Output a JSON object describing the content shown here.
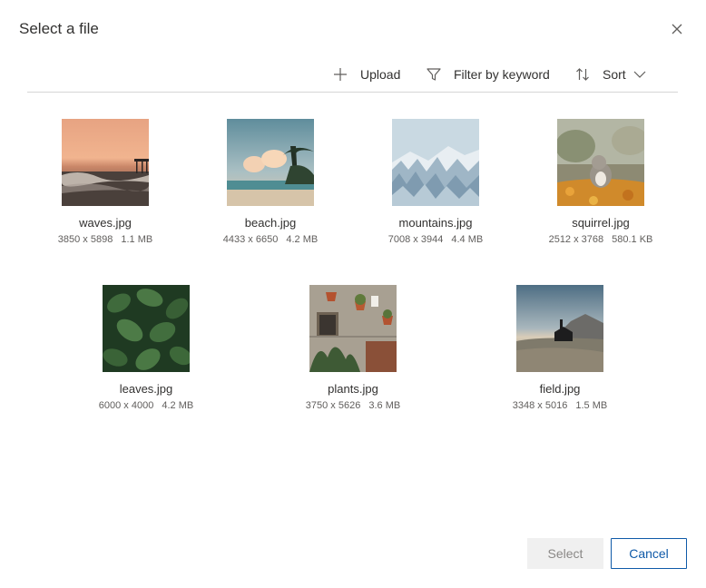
{
  "dialog": {
    "title": "Select a file"
  },
  "toolbar": {
    "upload_label": "Upload",
    "filter_label": "Filter by keyword",
    "sort_label": "Sort",
    "icons": [
      "plus-icon",
      "filter-icon",
      "sort-icon",
      "chevron-down-icon"
    ]
  },
  "files": [
    {
      "name": "waves.jpg",
      "dimensions": "3850 x 5898",
      "size": "1.1 MB"
    },
    {
      "name": "beach.jpg",
      "dimensions": "4433 x 6650",
      "size": "4.2 MB"
    },
    {
      "name": "mountains.jpg",
      "dimensions": "7008 x 3944",
      "size": "4.4 MB"
    },
    {
      "name": "squirrel.jpg",
      "dimensions": "2512 x 3768",
      "size": "580.1 KB"
    },
    {
      "name": "leaves.jpg",
      "dimensions": "6000 x 4000",
      "size": "4.2 MB"
    },
    {
      "name": "plants.jpg",
      "dimensions": "3750 x 5626",
      "size": "3.6 MB"
    },
    {
      "name": "field.jpg",
      "dimensions": "3348 x 5016",
      "size": "1.5 MB"
    }
  ],
  "footer": {
    "select_label": "Select",
    "cancel_label": "Cancel"
  },
  "colors": {
    "accent": "#0f5aa8",
    "disabled_bg": "#f0f0f0",
    "divider": "#d6d6d6"
  }
}
